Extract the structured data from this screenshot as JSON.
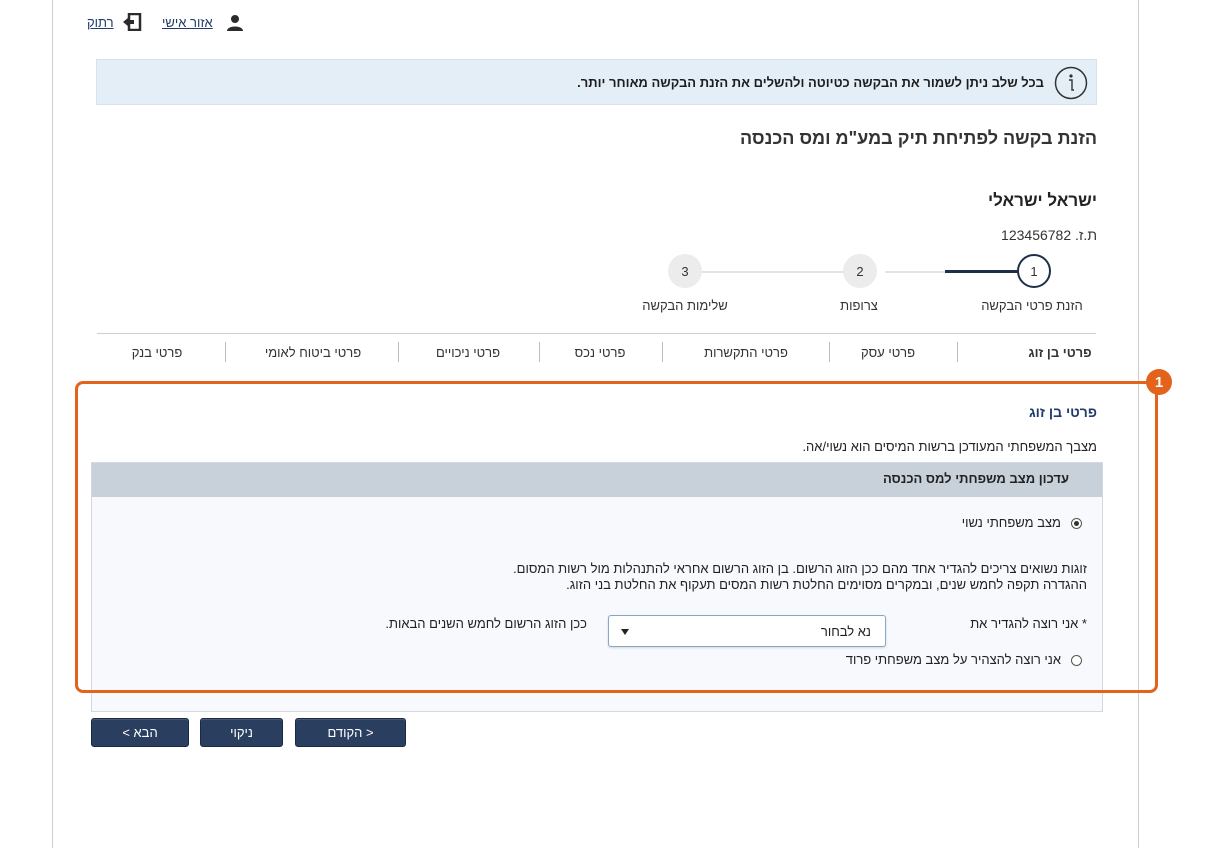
{
  "header": {
    "personal_area": "אזור אישי",
    "logout": "רתוק"
  },
  "banner": {
    "text_bold": "בכל שלב ניתן לשמור את הבקשה כטיוטה ולהשלים",
    "text_rest": " את הזנת הבקשה מאוחר יותר."
  },
  "page_title": "הזנת בקשה לפתיחת תיק במע\"מ ומס הכנסה",
  "user": {
    "name": "ישראל ישראלי",
    "id": "ת.ז. 123456782"
  },
  "stepper": {
    "steps": [
      {
        "number": "1",
        "label": "הזנת פרטי הבקשה",
        "active": true
      },
      {
        "number": "2",
        "label": "צרופות",
        "active": false
      },
      {
        "number": "3",
        "label": "שלימות הבקשה",
        "active": false
      }
    ]
  },
  "tabs": [
    {
      "label": "פרטי בן זוג",
      "active": true
    },
    {
      "label": "פרטי עסק"
    },
    {
      "label": "פרטי התקשרות"
    },
    {
      "label": "פרטי נכס"
    },
    {
      "label": "פרטי ניכויים"
    },
    {
      "label": "פרטי ביטוח לאומי"
    },
    {
      "label": "פרטי בנק"
    }
  ],
  "section": {
    "title": "פרטי בן זוג",
    "description": "מצבך המשפחתי המעודכן ברשות המיסים הוא נשוי/אה.",
    "panel_title": "עדכון מצב משפחתי למס הכנסה",
    "option_married": "מצב משפחתי נשוי",
    "paragraph_line1": "זוגות נשואים צריכים להגדיר אחד מהם ככן הזוג הרשום. בן הזוג הרשום אחראי להתנהלות מול רשות המסום.",
    "paragraph_line2": "ההגדרה תקפה לחמש שנים, ובמקרים מסוימים החלטת רשות המסים תעקוף את החלטת בני הזוג.",
    "define_label": "* אני רוצה להגדיר את",
    "select_value": "נא לבחור",
    "define_suffix": "ככן הזוג הרשום לחמש השנים הבאות.",
    "option_separated": "אני רוצה להצהיר על מצב משפחתי פרוד"
  },
  "annotation": {
    "marker": "1",
    "color": "#e3621c"
  },
  "buttons": {
    "prev": "< הקודם",
    "clear": "ניקוי",
    "next": "הבא >"
  },
  "colors": {
    "primary": "#2a3f5f",
    "banner_bg": "#e4eef7",
    "panel_header": "#c8d1da",
    "link": "#1f3c6b"
  }
}
